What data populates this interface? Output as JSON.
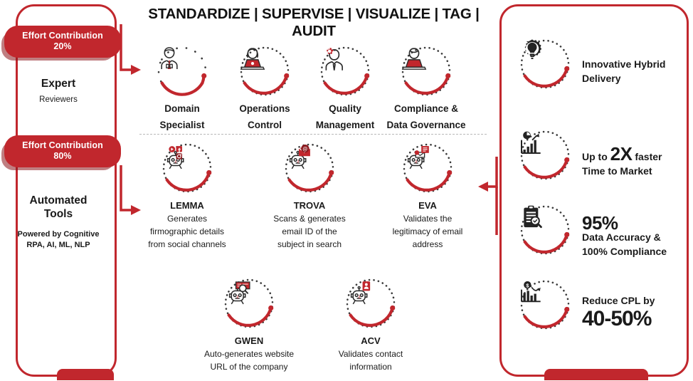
{
  "headline": "STANDARDIZE | SUPERVISE | VISUALIZE | TAG | AUDIT",
  "colors": {
    "accent": "#c1272d",
    "text": "#1a1a1a",
    "dotted": "#3a3a3a"
  },
  "left_panel": {
    "badge_top": {
      "line1": "Effort Contribution",
      "line2": "20%"
    },
    "badge_bottom": {
      "line1": "Effort Contribution",
      "line2": "80%"
    },
    "expert": {
      "title": "Expert",
      "subtitle": "Reviewers"
    },
    "automated": {
      "title_line1": "Automated",
      "title_line2": "Tools",
      "powered_line1": "Powered by Cognitive",
      "powered_line2": "RPA, AI, ML, NLP"
    }
  },
  "roles": [
    {
      "name_line1": "Domain",
      "name_line2": "Specialist",
      "icon": "person-suit-tie-icon"
    },
    {
      "name_line1": "Operations",
      "name_line2": "Control",
      "icon": "person-laptop-icon"
    },
    {
      "name_line1": "Quality",
      "name_line2": "Management",
      "icon": "person-gear-icon"
    },
    {
      "name_line1": "Compliance &",
      "name_line2": "Data Governance",
      "icon": "person-laptop-governance-icon"
    }
  ],
  "tools_row1": [
    {
      "name": "LEMMA",
      "desc_line1": "Generates",
      "desc_line2": "firmographic details",
      "desc_line3": "from social channels",
      "icon": "robot-social-icon"
    },
    {
      "name": "TROVA",
      "desc_line1": "Scans & generates",
      "desc_line2": "email ID of the",
      "desc_line3": "subject in search",
      "icon": "robot-email-icon"
    },
    {
      "name": "EVA",
      "desc_line1": "Validates the",
      "desc_line2": "legitimacy of email",
      "desc_line3": "address",
      "icon": "robot-email-validate-icon"
    }
  ],
  "tools_row2": [
    {
      "name": "GWEN",
      "desc_line1": "Auto-generates website",
      "desc_line2": "URL of the company",
      "desc_line3": "",
      "icon": "robot-search-web-icon"
    },
    {
      "name": "ACV",
      "desc_line1": "Validates contact",
      "desc_line2": "information",
      "desc_line3": "",
      "icon": "robot-contact-card-icon"
    }
  ],
  "benefits": [
    {
      "icon": "lightbulb-gear-icon",
      "line1": "Innovative Hybrid",
      "line2": "Delivery",
      "highlight": "",
      "style": "plain"
    },
    {
      "icon": "growth-chart-icon",
      "prefix": "Up to ",
      "highlight": "2X",
      "suffix": " faster",
      "line2": "Time to Market",
      "style": "inline-highlight"
    },
    {
      "icon": "clipboard-magnifier-icon",
      "highlight": "95%",
      "line1": "Data Accuracy &",
      "line2": "100% Compliance",
      "style": "stat-above"
    },
    {
      "icon": "declining-cost-chart-icon",
      "line1": "Reduce CPL by",
      "highlight": "40-50%",
      "style": "stat-below"
    }
  ]
}
